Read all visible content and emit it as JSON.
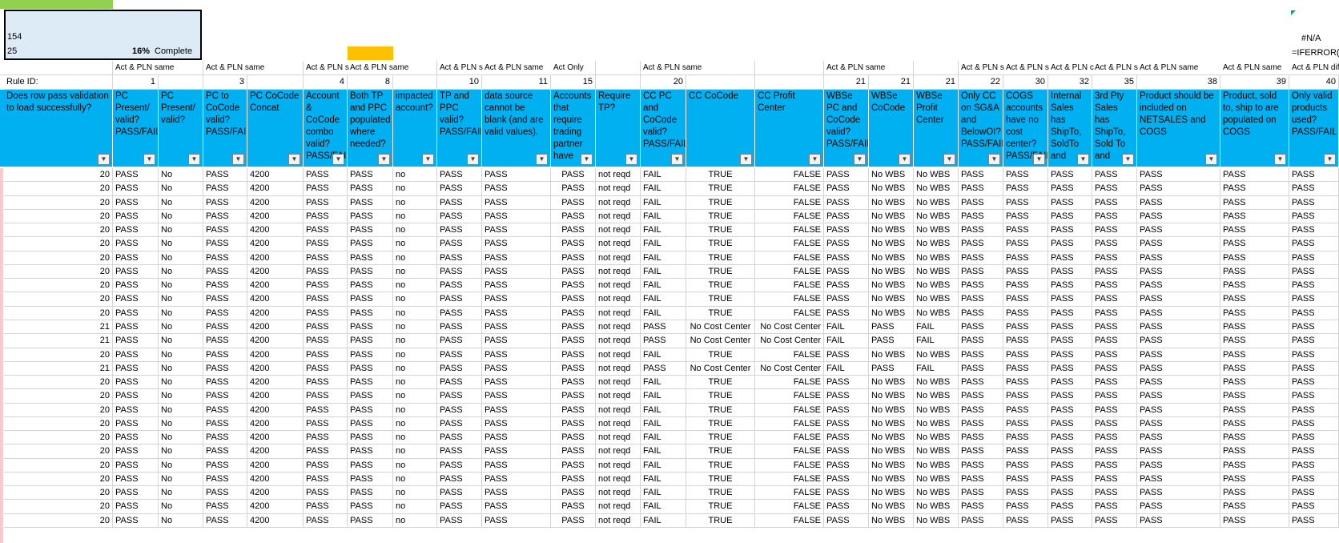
{
  "status": {
    "line1": "154",
    "line2": "25",
    "percent": "16%",
    "complete_label": "Complete"
  },
  "top_right": {
    "na": "#N/A",
    "formula": "=IFERROR(I"
  },
  "act_row": [
    "Act & PLN same",
    "",
    "Act & PLN same",
    "",
    "Act & PLN s",
    "Act & PLN same",
    "",
    "Act & PLN s",
    "Act & PLN same",
    "Act Only",
    "",
    "Act & PLN same",
    "",
    "",
    "Act & PLN same",
    "",
    "",
    "Act & PLN s",
    "Act & PLN s",
    "Act & PLN c",
    "Act & PLN s",
    "Act & PLN same",
    "Act & PLN same",
    "Act & PLN dif"
  ],
  "rule_row": {
    "label": "Rule ID:",
    "ids": [
      "1",
      "",
      "3",
      "",
      "4",
      "8",
      "",
      "10",
      "11",
      "15",
      "",
      "20",
      "",
      "",
      "21",
      "21",
      "21",
      "22",
      "30",
      "32",
      "35",
      "38",
      "39",
      "40"
    ]
  },
  "headers": [
    "Does row pass validation to load successfully?",
    "PC Present/ valid? PASS/FAIL",
    "PC Present/ valid?",
    "PC to CoCode valid? PASS/FAIL",
    "PC CoCode Concat",
    "Account & CoCode combo valid? PASS/FAIL",
    "Both TP and PPC populated where needed?",
    "impacted account?",
    "TP and PPC valid? PASS/FAIL",
    "data source cannot be blank (and are valid values).",
    "Accounts that require trading partner have",
    "Require TP?",
    "CC PC and CoCode valid? PASS/FAIL",
    "CC CoCode",
    "CC Profit Center",
    "WBSe PC and CoCode valid? PASS/FAIL",
    "WBSe CoCode",
    "WBSe Profit Center",
    "Only CC on SG&A and BelowOI? PASS/FAIL",
    "COGS accounts have no cost center? PASS/FAIL",
    "Internal Sales has ShipTo, SoldTo and",
    "3rd Pty Sales has ShipTo, Sold To and",
    "Product should be included on NETSALES and COGS",
    "Product, sold to, ship to are populated on COGS",
    "Only valid products used? PASS/FAIL"
  ],
  "rows": [
    [
      "20",
      "PASS",
      "No",
      "PASS",
      "4200",
      "PASS",
      "PASS",
      "no",
      "PASS",
      "PASS",
      "PASS",
      "not reqd",
      "FAIL",
      "TRUE",
      "FALSE",
      "PASS",
      "No WBS",
      "No WBS",
      "PASS",
      "PASS",
      "PASS",
      "PASS",
      "PASS",
      "PASS",
      "PASS"
    ],
    [
      "20",
      "PASS",
      "No",
      "PASS",
      "4200",
      "PASS",
      "PASS",
      "no",
      "PASS",
      "PASS",
      "PASS",
      "not reqd",
      "FAIL",
      "TRUE",
      "FALSE",
      "PASS",
      "No WBS",
      "No WBS",
      "PASS",
      "PASS",
      "PASS",
      "PASS",
      "PASS",
      "PASS",
      "PASS"
    ],
    [
      "20",
      "PASS",
      "No",
      "PASS",
      "4200",
      "PASS",
      "PASS",
      "no",
      "PASS",
      "PASS",
      "PASS",
      "not reqd",
      "FAIL",
      "TRUE",
      "FALSE",
      "PASS",
      "No WBS",
      "No WBS",
      "PASS",
      "PASS",
      "PASS",
      "PASS",
      "PASS",
      "PASS",
      "PASS"
    ],
    [
      "20",
      "PASS",
      "No",
      "PASS",
      "4200",
      "PASS",
      "PASS",
      "no",
      "PASS",
      "PASS",
      "PASS",
      "not reqd",
      "FAIL",
      "TRUE",
      "FALSE",
      "PASS",
      "No WBS",
      "No WBS",
      "PASS",
      "PASS",
      "PASS",
      "PASS",
      "PASS",
      "PASS",
      "PASS"
    ],
    [
      "20",
      "PASS",
      "No",
      "PASS",
      "4200",
      "PASS",
      "PASS",
      "no",
      "PASS",
      "PASS",
      "PASS",
      "not reqd",
      "FAIL",
      "TRUE",
      "FALSE",
      "PASS",
      "No WBS",
      "No WBS",
      "PASS",
      "PASS",
      "PASS",
      "PASS",
      "PASS",
      "PASS",
      "PASS"
    ],
    [
      "20",
      "PASS",
      "No",
      "PASS",
      "4200",
      "PASS",
      "PASS",
      "no",
      "PASS",
      "PASS",
      "PASS",
      "not reqd",
      "FAIL",
      "TRUE",
      "FALSE",
      "PASS",
      "No WBS",
      "No WBS",
      "PASS",
      "PASS",
      "PASS",
      "PASS",
      "PASS",
      "PASS",
      "PASS"
    ],
    [
      "20",
      "PASS",
      "No",
      "PASS",
      "4200",
      "PASS",
      "PASS",
      "no",
      "PASS",
      "PASS",
      "PASS",
      "not reqd",
      "FAIL",
      "TRUE",
      "FALSE",
      "PASS",
      "No WBS",
      "No WBS",
      "PASS",
      "PASS",
      "PASS",
      "PASS",
      "PASS",
      "PASS",
      "PASS"
    ],
    [
      "20",
      "PASS",
      "No",
      "PASS",
      "4200",
      "PASS",
      "PASS",
      "no",
      "PASS",
      "PASS",
      "PASS",
      "not reqd",
      "FAIL",
      "TRUE",
      "FALSE",
      "PASS",
      "No WBS",
      "No WBS",
      "PASS",
      "PASS",
      "PASS",
      "PASS",
      "PASS",
      "PASS",
      "PASS"
    ],
    [
      "20",
      "PASS",
      "No",
      "PASS",
      "4200",
      "PASS",
      "PASS",
      "no",
      "PASS",
      "PASS",
      "PASS",
      "not reqd",
      "FAIL",
      "TRUE",
      "FALSE",
      "PASS",
      "No WBS",
      "No WBS",
      "PASS",
      "PASS",
      "PASS",
      "PASS",
      "PASS",
      "PASS",
      "PASS"
    ],
    [
      "20",
      "PASS",
      "No",
      "PASS",
      "4200",
      "PASS",
      "PASS",
      "no",
      "PASS",
      "PASS",
      "PASS",
      "not reqd",
      "FAIL",
      "TRUE",
      "FALSE",
      "PASS",
      "No WBS",
      "No WBS",
      "PASS",
      "PASS",
      "PASS",
      "PASS",
      "PASS",
      "PASS",
      "PASS"
    ],
    [
      "20",
      "PASS",
      "No",
      "PASS",
      "4200",
      "PASS",
      "PASS",
      "no",
      "PASS",
      "PASS",
      "PASS",
      "not reqd",
      "FAIL",
      "TRUE",
      "FALSE",
      "PASS",
      "No WBS",
      "No WBS",
      "PASS",
      "PASS",
      "PASS",
      "PASS",
      "PASS",
      "PASS",
      "PASS"
    ],
    [
      "21",
      "PASS",
      "No",
      "PASS",
      "4200",
      "PASS",
      "PASS",
      "no",
      "PASS",
      "PASS",
      "PASS",
      "not reqd",
      "PASS",
      "No Cost Center",
      "No Cost Center",
      "FAIL",
      "PASS",
      "FAIL",
      "PASS",
      "PASS",
      "PASS",
      "PASS",
      "PASS",
      "PASS",
      "PASS"
    ],
    [
      "21",
      "PASS",
      "No",
      "PASS",
      "4200",
      "PASS",
      "PASS",
      "no",
      "PASS",
      "PASS",
      "PASS",
      "not reqd",
      "PASS",
      "No Cost Center",
      "No Cost Center",
      "FAIL",
      "PASS",
      "FAIL",
      "PASS",
      "PASS",
      "PASS",
      "PASS",
      "PASS",
      "PASS",
      "PASS"
    ],
    [
      "20",
      "PASS",
      "No",
      "PASS",
      "4200",
      "PASS",
      "PASS",
      "no",
      "PASS",
      "PASS",
      "PASS",
      "not reqd",
      "FAIL",
      "TRUE",
      "FALSE",
      "PASS",
      "No WBS",
      "No WBS",
      "PASS",
      "PASS",
      "PASS",
      "PASS",
      "PASS",
      "PASS",
      "PASS"
    ],
    [
      "21",
      "PASS",
      "No",
      "PASS",
      "4200",
      "PASS",
      "PASS",
      "no",
      "PASS",
      "PASS",
      "PASS",
      "not reqd",
      "PASS",
      "No Cost Center",
      "No Cost Center",
      "FAIL",
      "PASS",
      "FAIL",
      "PASS",
      "PASS",
      "PASS",
      "PASS",
      "PASS",
      "PASS",
      "PASS"
    ],
    [
      "20",
      "PASS",
      "No",
      "PASS",
      "4200",
      "PASS",
      "PASS",
      "no",
      "PASS",
      "PASS",
      "PASS",
      "not reqd",
      "FAIL",
      "TRUE",
      "FALSE",
      "PASS",
      "No WBS",
      "No WBS",
      "PASS",
      "PASS",
      "PASS",
      "PASS",
      "PASS",
      "PASS",
      "PASS"
    ],
    [
      "20",
      "PASS",
      "No",
      "PASS",
      "4200",
      "PASS",
      "PASS",
      "no",
      "PASS",
      "PASS",
      "PASS",
      "not reqd",
      "FAIL",
      "TRUE",
      "FALSE",
      "PASS",
      "No WBS",
      "No WBS",
      "PASS",
      "PASS",
      "PASS",
      "PASS",
      "PASS",
      "PASS",
      "PASS"
    ],
    [
      "20",
      "PASS",
      "No",
      "PASS",
      "4200",
      "PASS",
      "PASS",
      "no",
      "PASS",
      "PASS",
      "PASS",
      "not reqd",
      "FAIL",
      "TRUE",
      "FALSE",
      "PASS",
      "No WBS",
      "No WBS",
      "PASS",
      "PASS",
      "PASS",
      "PASS",
      "PASS",
      "PASS",
      "PASS"
    ],
    [
      "20",
      "PASS",
      "No",
      "PASS",
      "4200",
      "PASS",
      "PASS",
      "no",
      "PASS",
      "PASS",
      "PASS",
      "not reqd",
      "FAIL",
      "TRUE",
      "FALSE",
      "PASS",
      "No WBS",
      "No WBS",
      "PASS",
      "PASS",
      "PASS",
      "PASS",
      "PASS",
      "PASS",
      "PASS"
    ],
    [
      "20",
      "PASS",
      "No",
      "PASS",
      "4200",
      "PASS",
      "PASS",
      "no",
      "PASS",
      "PASS",
      "PASS",
      "not reqd",
      "FAIL",
      "TRUE",
      "FALSE",
      "PASS",
      "No WBS",
      "No WBS",
      "PASS",
      "PASS",
      "PASS",
      "PASS",
      "PASS",
      "PASS",
      "PASS"
    ],
    [
      "20",
      "PASS",
      "No",
      "PASS",
      "4200",
      "PASS",
      "PASS",
      "no",
      "PASS",
      "PASS",
      "PASS",
      "not reqd",
      "FAIL",
      "TRUE",
      "FALSE",
      "PASS",
      "No WBS",
      "No WBS",
      "PASS",
      "PASS",
      "PASS",
      "PASS",
      "PASS",
      "PASS",
      "PASS"
    ],
    [
      "20",
      "PASS",
      "No",
      "PASS",
      "4200",
      "PASS",
      "PASS",
      "no",
      "PASS",
      "PASS",
      "PASS",
      "not reqd",
      "FAIL",
      "TRUE",
      "FALSE",
      "PASS",
      "No WBS",
      "No WBS",
      "PASS",
      "PASS",
      "PASS",
      "PASS",
      "PASS",
      "PASS",
      "PASS"
    ],
    [
      "20",
      "PASS",
      "No",
      "PASS",
      "4200",
      "PASS",
      "PASS",
      "no",
      "PASS",
      "PASS",
      "PASS",
      "not reqd",
      "FAIL",
      "TRUE",
      "FALSE",
      "PASS",
      "No WBS",
      "No WBS",
      "PASS",
      "PASS",
      "PASS",
      "PASS",
      "PASS",
      "PASS",
      "PASS"
    ],
    [
      "20",
      "PASS",
      "No",
      "PASS",
      "4200",
      "PASS",
      "PASS",
      "no",
      "PASS",
      "PASS",
      "PASS",
      "not reqd",
      "FAIL",
      "TRUE",
      "FALSE",
      "PASS",
      "No WBS",
      "No WBS",
      "PASS",
      "PASS",
      "PASS",
      "PASS",
      "PASS",
      "PASS",
      "PASS"
    ],
    [
      "20",
      "PASS",
      "No",
      "PASS",
      "4200",
      "PASS",
      "PASS",
      "no",
      "PASS",
      "PASS",
      "PASS",
      "not reqd",
      "FAIL",
      "TRUE",
      "FALSE",
      "PASS",
      "No WBS",
      "No WBS",
      "PASS",
      "PASS",
      "PASS",
      "PASS",
      "PASS",
      "PASS",
      "PASS"
    ],
    [
      "20",
      "PASS",
      "No",
      "PASS",
      "4200",
      "PASS",
      "PASS",
      "no",
      "PASS",
      "PASS",
      "PASS",
      "not reqd",
      "FAIL",
      "TRUE",
      "FALSE",
      "PASS",
      "No WBS",
      "No WBS",
      "PASS",
      "PASS",
      "PASS",
      "PASS",
      "PASS",
      "PASS",
      "PASS"
    ]
  ],
  "filter_icon": "filter-dropdown-icon"
}
